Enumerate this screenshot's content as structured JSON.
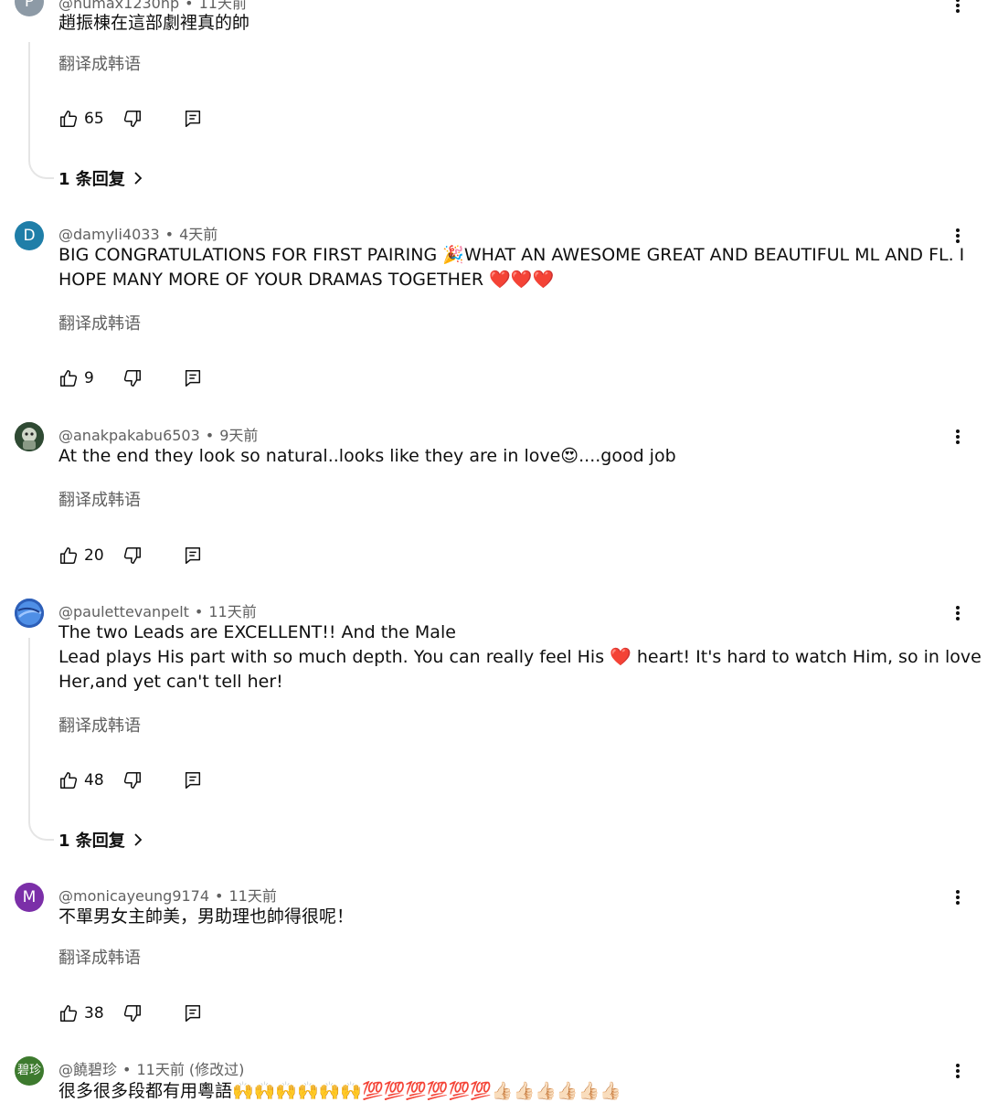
{
  "translate_label": "翻译成韩语",
  "comments": [
    {
      "author": "@humax1230hp",
      "time": "11天前",
      "avatar_letter": "P",
      "avatar_color": "#8d9aa6",
      "lines": [
        "趙振棟在這部劇裡真的帥"
      ],
      "likes": "65",
      "replies_label": "1 条回复"
    },
    {
      "author": "@damyli4033",
      "time": "4天前",
      "avatar_letter": "D",
      "avatar_color": "#1f7ea8",
      "lines": [
        "BIG CONGRATULATIONS FOR FIRST PAIRING 🎉WHAT AN AWESOME GREAT AND BEAUTIFUL ML AND FL. I",
        "HOPE MANY MORE OF YOUR DRAMAS TOGETHER ❤️❤️❤️"
      ],
      "likes": "9"
    },
    {
      "author": "@anakpakabu6503",
      "time": "9天前",
      "avatar_letter": "",
      "avatar_color": "#3f5540",
      "lines": [
        "At the end they look so natural..looks like they are in love😍....good job"
      ],
      "likes": "20"
    },
    {
      "author": "@paulettevanpelt",
      "time": "11天前",
      "avatar_letter": "",
      "avatar_color": "#3a6fd0",
      "lines": [
        "The two Leads are EXCELLENT!! And the Male",
        "Lead plays His part with so much depth. You can really feel His ❤️ heart! It's hard to watch Him, so in love with",
        "Her,and yet can't tell her!"
      ],
      "likes": "48",
      "replies_label": "1 条回复"
    },
    {
      "author": "@monicayeung9174",
      "time": "11天前",
      "avatar_letter": "M",
      "avatar_color": "#7b2fa8",
      "lines": [
        "不單男女主帥美，男助理也帥得很呢！"
      ],
      "likes": "38"
    },
    {
      "author": "@饒碧珍",
      "time": "11天前 (修改过)",
      "avatar_letter": "碧珍",
      "avatar_color": "#3d7a2e",
      "lines": [
        "很多很多段都有用粵語🙌🙌🙌🙌🙌🙌💯💯💯💯💯💯👍🏻👍🏻👍🏻👍🏻👍🏻👍🏻"
      ]
    }
  ]
}
